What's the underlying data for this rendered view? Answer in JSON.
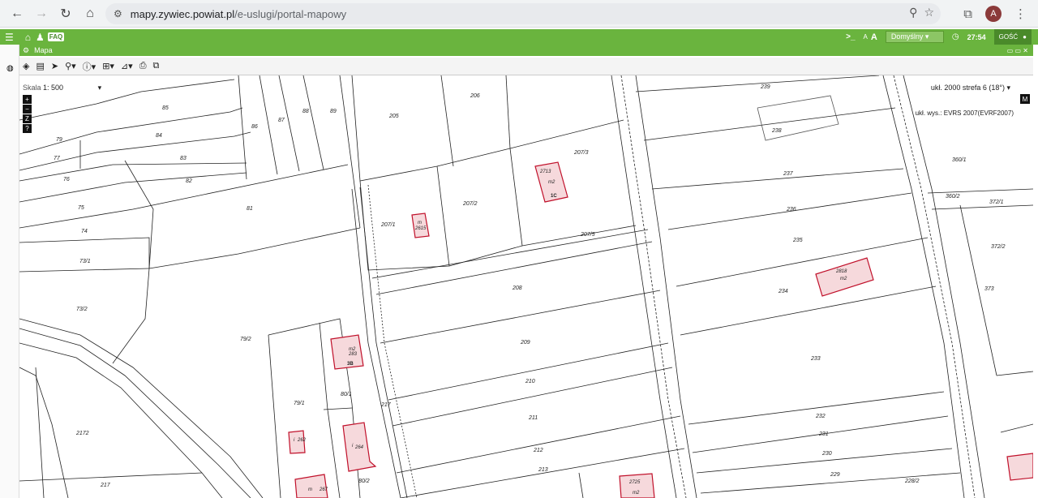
{
  "browser": {
    "url_host": "mapy.zywiec.powiat.pl",
    "url_path": "/e-uslugi/portal-mapowy",
    "avatar_letter": "A"
  },
  "app": {
    "faq_label": "FAQ",
    "font_small": "A",
    "font_large": "A",
    "preset": "Domyślny",
    "time": "27:54",
    "user": "GOŚĆ"
  },
  "panel": {
    "title": "Mapa"
  },
  "map": {
    "scale_label": "Skala",
    "scale_value": "1: 500",
    "crs": "ukł. 2000 strefa 6 (18°)",
    "vertical": "ukł. wys.: EVRS 2007(EVRF2007)",
    "zoom": [
      "+",
      "−",
      "Z",
      "?"
    ],
    "crs_button": "M"
  },
  "parcels": [
    "85",
    "84",
    "83",
    "82",
    "79",
    "77",
    "76",
    "75",
    "74",
    "73/1",
    "73/2",
    "81",
    "86",
    "87",
    "88",
    "89",
    "205",
    "206",
    "207/3",
    "207/2",
    "207/1",
    "207/5",
    "208",
    "209",
    "210",
    "211",
    "212",
    "213",
    "239",
    "238",
    "237",
    "236",
    "235",
    "234",
    "233",
    "232",
    "231",
    "230",
    "229",
    "228/2",
    "360/1",
    "360/2",
    "372/1",
    "372/2",
    "373",
    "79/2",
    "79/1",
    "80/1",
    "80/2",
    "2172",
    "217"
  ],
  "buildings": [
    {
      "id": "2713",
      "use": "m2",
      "label": "1C"
    },
    {
      "id": "2615",
      "use": "m"
    },
    {
      "id": "2818",
      "use": "m2"
    },
    {
      "id": "283",
      "use": "m2",
      "label": "3B"
    },
    {
      "id": "264",
      "use": "i"
    },
    {
      "id": "262",
      "use": "i"
    },
    {
      "id": "2725",
      "use": "m2"
    }
  ]
}
